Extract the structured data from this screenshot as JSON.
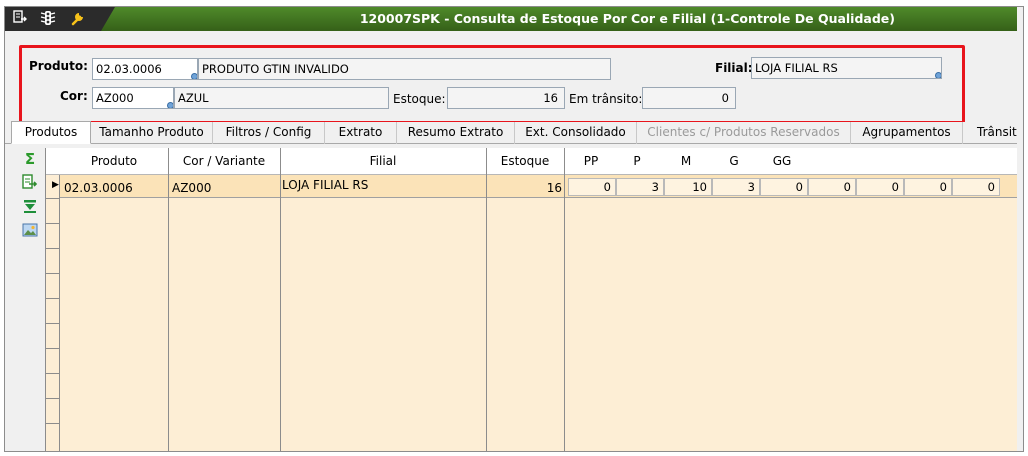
{
  "window": {
    "title": "120007SPK - Consulta de Estoque Por Cor e Filial (1-Controle De Qualidade)",
    "icons": [
      "document-arrow-icon",
      "traffic-light-icon",
      "wrench-icon"
    ]
  },
  "form": {
    "produto_label": "Produto:",
    "produto_code": "02.03.0006",
    "produto_desc": "PRODUTO GTIN INVALIDO",
    "filial_label": "Filial:",
    "filial_value": "LOJA FILIAL RS",
    "cor_label": "Cor:",
    "cor_code": "AZ000",
    "cor_desc": "AZUL",
    "estoque_label": "Estoque:",
    "estoque_value": "16",
    "transito_label": "Em trânsito:",
    "transito_value": "0"
  },
  "tabs": [
    {
      "label": "Produtos",
      "active": true
    },
    {
      "label": "Tamanho Produto"
    },
    {
      "label": "Filtros / Config"
    },
    {
      "label": "Extrato"
    },
    {
      "label": "Resumo Extrato"
    },
    {
      "label": "Ext. Consolidado"
    },
    {
      "label": "Clientes c/ Produtos Reservados",
      "disabled": true
    },
    {
      "label": "Agrupamentos"
    },
    {
      "label": "Trânsit"
    }
  ],
  "sidetools": [
    "sum-icon",
    "export-icon",
    "filter-down-icon",
    "image-icon"
  ],
  "grid": {
    "headers": [
      "Produto",
      "Cor / Variante",
      "Filial",
      "Estoque",
      "PP",
      "P",
      "M",
      "G",
      "GG"
    ],
    "rows": [
      {
        "produto": "02.03.0006",
        "cor": "AZ000",
        "filial": "LOJA FILIAL RS",
        "estoque": "16",
        "sizes": [
          "0",
          "3",
          "10",
          "3",
          "0",
          "0",
          "0",
          "0",
          "0"
        ]
      }
    ]
  },
  "colors": {
    "title_green": "#3f6f1f",
    "highlight_red": "#e8141c",
    "grid_bg": "#fdeed5",
    "selected_row": "#fbe3b8"
  }
}
